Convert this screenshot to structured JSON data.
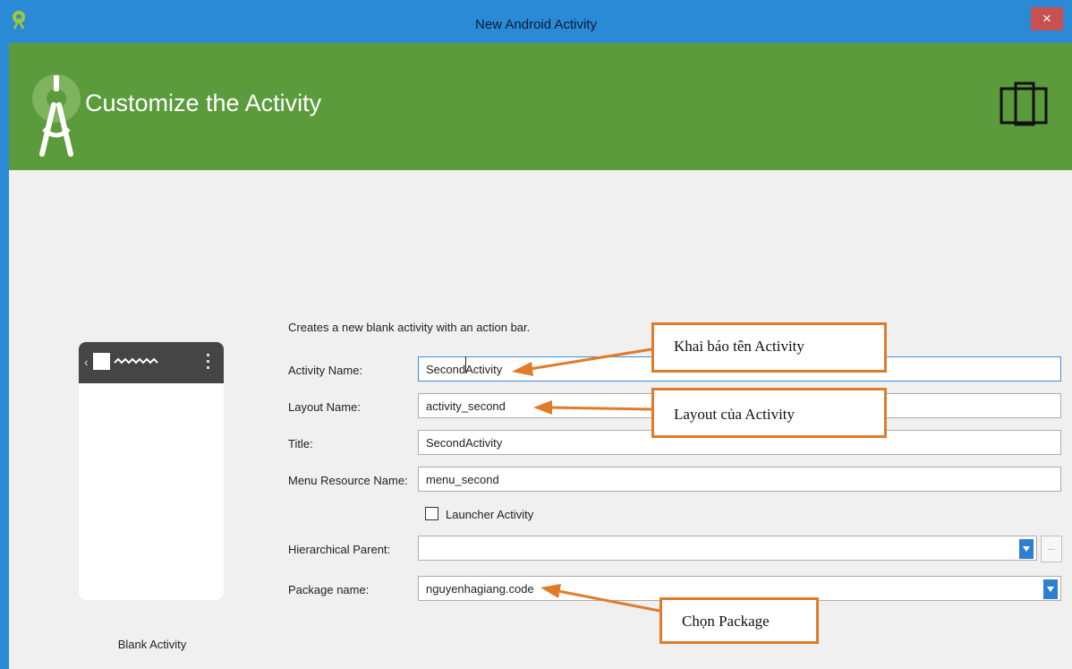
{
  "window": {
    "title": "New Android Activity",
    "close_glyph": "×"
  },
  "banner": {
    "title": "Customize the Activity",
    "logo_icon": "android-studio-icon",
    "device_icon": "phone-tablet-icon"
  },
  "preview": {
    "caption": "Blank Activity",
    "back_glyph": "‹"
  },
  "description": "Creates a new blank activity with an action bar.",
  "form": {
    "activity_name": {
      "label": "Activity Name:",
      "value": "SecondActivity"
    },
    "layout_name": {
      "label": "Layout Name:",
      "value": "activity_second"
    },
    "title": {
      "label": "Title:",
      "value": "SecondActivity"
    },
    "menu_resource_name": {
      "label": "Menu Resource Name:",
      "value": "menu_second"
    },
    "launcher_activity": {
      "label": "Launcher Activity",
      "checked": false
    },
    "hierarchical_parent": {
      "label": "Hierarchical Parent:",
      "value": "",
      "browse_label": "..."
    },
    "package_name": {
      "label": "Package name:",
      "value": "nguyenhagiang.code"
    }
  },
  "annotations": {
    "activity_name": "Khai báo tên Activity",
    "layout": "Layout của Activity",
    "package": "Chọn Package"
  },
  "colors": {
    "titlebar": "#2b8ad6",
    "banner": "#5b9b3c",
    "callout": "#e07b2a",
    "dropdown": "#2d7fd2"
  }
}
